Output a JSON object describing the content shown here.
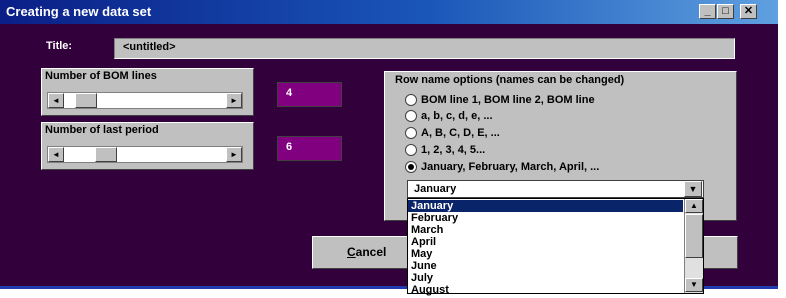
{
  "window": {
    "title": "Creating a new data set",
    "controls": {
      "minimize": "_",
      "maximize": "□",
      "close": "✕"
    }
  },
  "title_field": {
    "label": "Title:",
    "value": "<untitled>"
  },
  "bom_lines": {
    "label": "Number of BOM lines",
    "value": "4",
    "left_arrow": "◄",
    "right_arrow": "►"
  },
  "last_period": {
    "label": "Number of last period",
    "value": "6",
    "left_arrow": "◄",
    "right_arrow": "►"
  },
  "row_options": {
    "label": "Row name options (names can be changed)",
    "options": [
      {
        "label": "BOM line 1, BOM line 2, BOM line",
        "checked": false
      },
      {
        "label": "a, b, c, d, e, ...",
        "checked": false
      },
      {
        "label": "A, B, C, D, E, ...",
        "checked": false
      },
      {
        "label": "1, 2, 3, 4, 5...",
        "checked": false
      },
      {
        "label": "January, February, March, April, ...",
        "checked": true
      }
    ]
  },
  "month_combo": {
    "value": "January",
    "arrow": "▼",
    "scroll_up": "▲",
    "scroll_down": "▼",
    "items": [
      "January",
      "February",
      "March",
      "April",
      "May",
      "June",
      "July",
      "August"
    ],
    "selected": "January"
  },
  "cancel_button": {
    "label_underlined": "C",
    "label_rest": "ancel"
  }
}
